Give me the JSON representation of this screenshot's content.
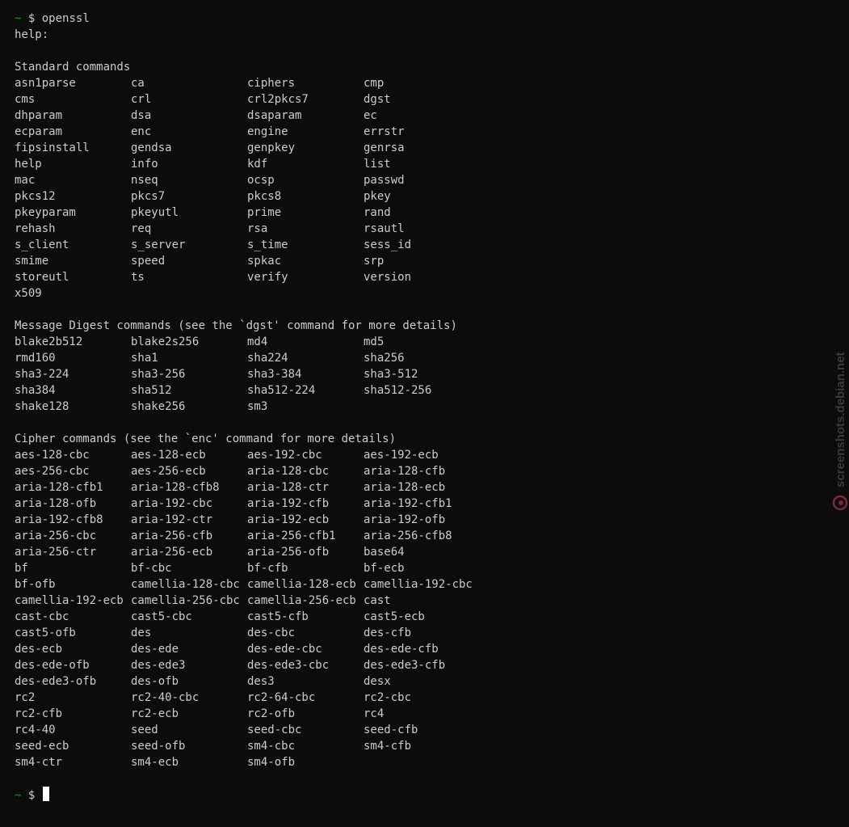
{
  "prompt": {
    "tilde": "~",
    "dollar": "$"
  },
  "command": "openssl",
  "help_label": "help:",
  "sections": [
    {
      "heading": "Standard commands",
      "rows": [
        [
          "asn1parse",
          "ca",
          "ciphers",
          "cmp"
        ],
        [
          "cms",
          "crl",
          "crl2pkcs7",
          "dgst"
        ],
        [
          "dhparam",
          "dsa",
          "dsaparam",
          "ec"
        ],
        [
          "ecparam",
          "enc",
          "engine",
          "errstr"
        ],
        [
          "fipsinstall",
          "gendsa",
          "genpkey",
          "genrsa"
        ],
        [
          "help",
          "info",
          "kdf",
          "list"
        ],
        [
          "mac",
          "nseq",
          "ocsp",
          "passwd"
        ],
        [
          "pkcs12",
          "pkcs7",
          "pkcs8",
          "pkey"
        ],
        [
          "pkeyparam",
          "pkeyutl",
          "prime",
          "rand"
        ],
        [
          "rehash",
          "req",
          "rsa",
          "rsautl"
        ],
        [
          "s_client",
          "s_server",
          "s_time",
          "sess_id"
        ],
        [
          "smime",
          "speed",
          "spkac",
          "srp"
        ],
        [
          "storeutl",
          "ts",
          "verify",
          "version"
        ],
        [
          "x509"
        ]
      ]
    },
    {
      "heading": "Message Digest commands (see the `dgst' command for more details)",
      "rows": [
        [
          "blake2b512",
          "blake2s256",
          "md4",
          "md5"
        ],
        [
          "rmd160",
          "sha1",
          "sha224",
          "sha256"
        ],
        [
          "sha3-224",
          "sha3-256",
          "sha3-384",
          "sha3-512"
        ],
        [
          "sha384",
          "sha512",
          "sha512-224",
          "sha512-256"
        ],
        [
          "shake128",
          "shake256",
          "sm3"
        ]
      ]
    },
    {
      "heading": "Cipher commands (see the `enc' command for more details)",
      "rows": [
        [
          "aes-128-cbc",
          "aes-128-ecb",
          "aes-192-cbc",
          "aes-192-ecb"
        ],
        [
          "aes-256-cbc",
          "aes-256-ecb",
          "aria-128-cbc",
          "aria-128-cfb"
        ],
        [
          "aria-128-cfb1",
          "aria-128-cfb8",
          "aria-128-ctr",
          "aria-128-ecb"
        ],
        [
          "aria-128-ofb",
          "aria-192-cbc",
          "aria-192-cfb",
          "aria-192-cfb1"
        ],
        [
          "aria-192-cfb8",
          "aria-192-ctr",
          "aria-192-ecb",
          "aria-192-ofb"
        ],
        [
          "aria-256-cbc",
          "aria-256-cfb",
          "aria-256-cfb1",
          "aria-256-cfb8"
        ],
        [
          "aria-256-ctr",
          "aria-256-ecb",
          "aria-256-ofb",
          "base64"
        ],
        [
          "bf",
          "bf-cbc",
          "bf-cfb",
          "bf-ecb"
        ],
        [
          "bf-ofb",
          "camellia-128-cbc",
          "camellia-128-ecb",
          "camellia-192-cbc"
        ],
        [
          "camellia-192-ecb",
          "camellia-256-cbc",
          "camellia-256-ecb",
          "cast"
        ],
        [
          "cast-cbc",
          "cast5-cbc",
          "cast5-cfb",
          "cast5-ecb"
        ],
        [
          "cast5-ofb",
          "des",
          "des-cbc",
          "des-cfb"
        ],
        [
          "des-ecb",
          "des-ede",
          "des-ede-cbc",
          "des-ede-cfb"
        ],
        [
          "des-ede-ofb",
          "des-ede3",
          "des-ede3-cbc",
          "des-ede3-cfb"
        ],
        [
          "des-ede3-ofb",
          "des-ofb",
          "des3",
          "desx"
        ],
        [
          "rc2",
          "rc2-40-cbc",
          "rc2-64-cbc",
          "rc2-cbc"
        ],
        [
          "rc2-cfb",
          "rc2-ecb",
          "rc2-ofb",
          "rc4"
        ],
        [
          "rc4-40",
          "seed",
          "seed-cbc",
          "seed-cfb"
        ],
        [
          "seed-ecb",
          "seed-ofb",
          "sm4-cbc",
          "sm4-cfb"
        ],
        [
          "sm4-ctr",
          "sm4-ecb",
          "sm4-ofb"
        ]
      ]
    }
  ],
  "watermark": {
    "text": "screenshots.debian.net",
    "color": "#3a3a3a",
    "icon": "debian-swirl-icon"
  },
  "colors": {
    "background": "#0c0c0c",
    "foreground": "#cccccc",
    "prompt_tilde": "#13a10e",
    "cursor": "#ffffff"
  }
}
